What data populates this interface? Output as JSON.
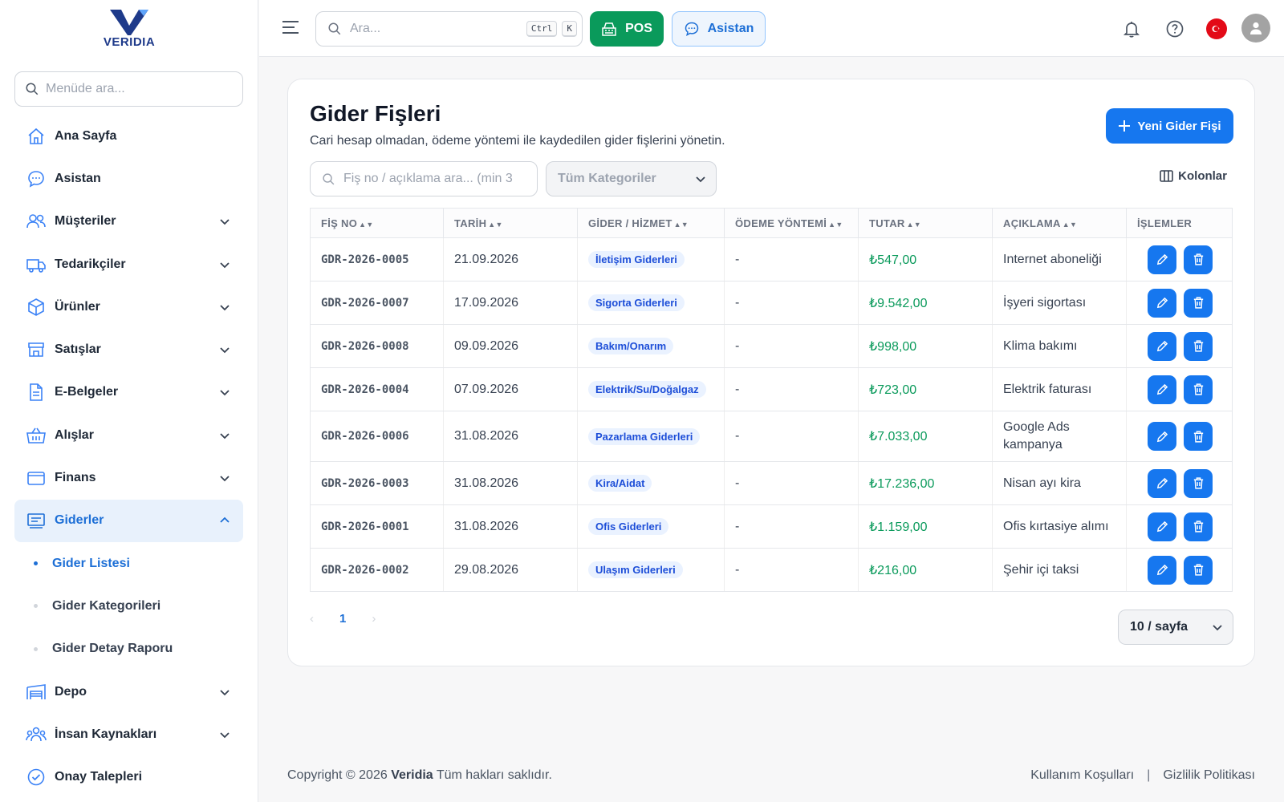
{
  "brand": {
    "name": "VERIDIA",
    "accent": "#1677ef",
    "pos_color": "#0a9a5b"
  },
  "sidebar": {
    "search_placeholder": "Menüde ara...",
    "items": [
      {
        "label": "Ana Sayfa",
        "icon": "home-icon",
        "chevron": false
      },
      {
        "label": "Asistan",
        "icon": "chat-bubble-icon",
        "chevron": false
      },
      {
        "label": "Müşteriler",
        "icon": "users-icon",
        "chevron": true
      },
      {
        "label": "Tedarikçiler",
        "icon": "truck-icon",
        "chevron": true
      },
      {
        "label": "Ürünler",
        "icon": "box-icon",
        "chevron": true
      },
      {
        "label": "Satışlar",
        "icon": "store-icon",
        "chevron": true
      },
      {
        "label": "E-Belgeler",
        "icon": "document-icon",
        "chevron": true
      },
      {
        "label": "Alışlar",
        "icon": "basket-icon",
        "chevron": true
      },
      {
        "label": "Finans",
        "icon": "wallet-icon",
        "chevron": true
      },
      {
        "label": "Giderler",
        "icon": "receipt-icon",
        "chevron": true,
        "active": true
      }
    ],
    "sub_items": [
      {
        "label": "Gider Listesi",
        "active": true
      },
      {
        "label": "Gider Kategorileri"
      },
      {
        "label": "Gider Detay Raporu"
      }
    ],
    "items_after": [
      {
        "label": "Depo",
        "icon": "warehouse-icon",
        "chevron": true
      },
      {
        "label": "İnsan Kaynakları",
        "icon": "team-icon",
        "chevron": true
      },
      {
        "label": "Onay Talepleri",
        "icon": "check-circle-icon",
        "chevron": false
      }
    ]
  },
  "topbar": {
    "search_placeholder": "Ara...",
    "kbd_ctrl": "Ctrl",
    "kbd_k": "K",
    "pos_label": "POS",
    "asistan_label": "Asistan"
  },
  "page": {
    "title": "Gider Fişleri",
    "description": "Cari hesap olmadan, ödeme yöntemi ile kaydedilen gider fişlerini yönetin.",
    "new_button": "Yeni Gider Fişi",
    "search_placeholder": "Fiş no / açıklama ara... (min 3",
    "category_placeholder": "Tüm Kategoriler",
    "columns_button": "Kolonlar"
  },
  "table": {
    "headers": [
      "FİŞ NO",
      "TARİH",
      "GİDER / HİZMET",
      "ÖDEME YÖNTEMİ",
      "TUTAR",
      "AÇIKLAMA",
      "İŞLEMLER"
    ],
    "rows": [
      {
        "no": "GDR-2026-0005",
        "date": "21.09.2026",
        "category": "İletişim Giderleri",
        "payment": "-",
        "amount": "₺547,00",
        "desc": "Internet aboneliği"
      },
      {
        "no": "GDR-2026-0007",
        "date": "17.09.2026",
        "category": "Sigorta Giderleri",
        "payment": "-",
        "amount": "₺9.542,00",
        "desc": "İşyeri sigortası"
      },
      {
        "no": "GDR-2026-0008",
        "date": "09.09.2026",
        "category": "Bakım/Onarım",
        "payment": "-",
        "amount": "₺998,00",
        "desc": "Klima bakımı"
      },
      {
        "no": "GDR-2026-0004",
        "date": "07.09.2026",
        "category": "Elektrik/Su/Doğalgaz",
        "payment": "-",
        "amount": "₺723,00",
        "desc": "Elektrik faturası"
      },
      {
        "no": "GDR-2026-0006",
        "date": "31.08.2026",
        "category": "Pazarlama Giderleri",
        "payment": "-",
        "amount": "₺7.033,00",
        "desc": "Google Ads kampanya"
      },
      {
        "no": "GDR-2026-0003",
        "date": "31.08.2026",
        "category": "Kira/Aidat",
        "payment": "-",
        "amount": "₺17.236,00",
        "desc": "Nisan ayı kira"
      },
      {
        "no": "GDR-2026-0001",
        "date": "31.08.2026",
        "category": "Ofis Giderleri",
        "payment": "-",
        "amount": "₺1.159,00",
        "desc": "Ofis kırtasiye alımı"
      },
      {
        "no": "GDR-2026-0002",
        "date": "29.08.2026",
        "category": "Ulaşım Giderleri",
        "payment": "-",
        "amount": "₺216,00",
        "desc": "Şehir içi taksi"
      }
    ]
  },
  "pagination": {
    "prev": "‹",
    "current": "1",
    "next": "›",
    "per_page": "10 / sayfa"
  },
  "footer": {
    "copyright_prefix": "Copyright © 2026",
    "company": "Veridia",
    "copyright_suffix": "Tüm hakları saklıdır.",
    "terms": "Kullanım Koşulları",
    "separator": "|",
    "privacy": "Gizlilik Politikası"
  }
}
